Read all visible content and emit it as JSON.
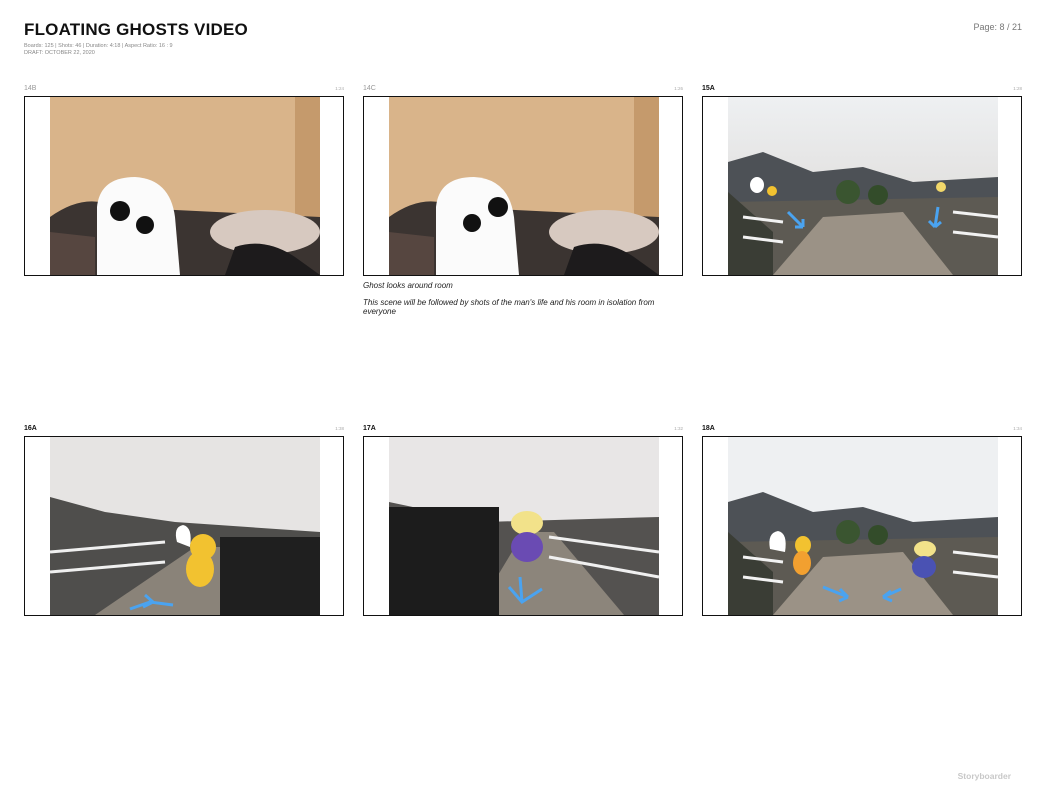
{
  "document": {
    "title": "FLOATING GHOSTS VIDEO",
    "meta_line": "Boards: 125  |  Shots: 46  |  Duration: 4:18  |  Aspect Ratio: 16 : 9",
    "draft_line": "DRAFT: OCTOBER 22, 2020",
    "page": "Page: 8 / 21",
    "brand": "Storyboarder"
  },
  "boards": [
    {
      "id": "14B",
      "time": "1:24",
      "captions": []
    },
    {
      "id": "14C",
      "time": "1:26",
      "captions": [
        "Ghost looks around room",
        "This scene will be followed by shots of the man's life and his room in isolation from everyone"
      ]
    },
    {
      "id": "15A",
      "time": "1:28",
      "captions": []
    },
    {
      "id": "16A",
      "time": "1:38",
      "captions": []
    },
    {
      "id": "17A",
      "time": "1:32",
      "captions": []
    },
    {
      "id": "18A",
      "time": "1:34",
      "captions": []
    }
  ],
  "colors": {
    "arrow": "#4aa3f0",
    "wall": "#d8b58a",
    "ghost": "#ffffff",
    "yellow_char": "#f2c230",
    "purple_char": "#6a4bb3"
  }
}
